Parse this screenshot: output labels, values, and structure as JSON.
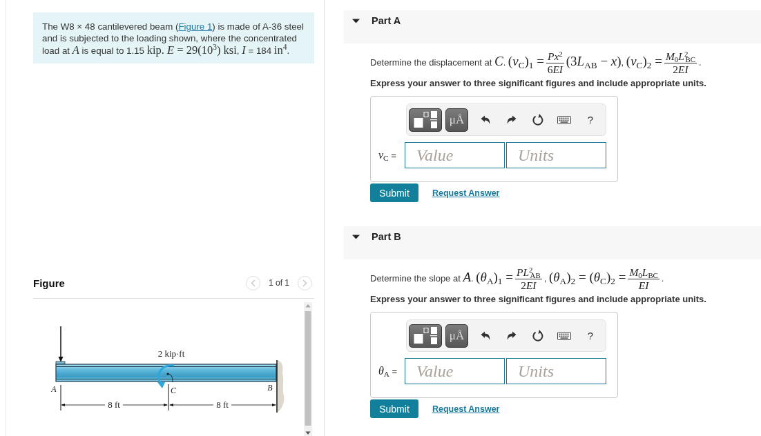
{
  "problem": {
    "text": [
      {
        "kind": "text",
        "text": "The W8 × 48 cantilevered beam ("
      },
      {
        "kind": "link",
        "text": "Figure 1"
      },
      {
        "kind": "text",
        "text": ") is made of A-36 steel and is subjected to the loading shown, where the concentrated load at "
      },
      {
        "kind": "math",
        "text": "*A*"
      },
      {
        "kind": "text",
        "text": " is equal to 1.15 "
      },
      {
        "kind": "math",
        "text": "kip. *E* = 29(10$^{3}$) ksi"
      },
      {
        "kind": "text",
        "text": ", "
      },
      {
        "kind": "math",
        "text": "*I*"
      },
      {
        "kind": "text",
        "text": " = 184 "
      },
      {
        "kind": "math",
        "text": "in$^{4}$"
      },
      {
        "kind": "text",
        "text": "."
      }
    ]
  },
  "figure": {
    "title": "Figure",
    "pager": "1 of 1",
    "previous": {
      "disabled": true
    },
    "next": {
      "disabled": true
    },
    "diagram": {
      "moment": "2 kip·ft",
      "points": [
        "A",
        "C",
        "B"
      ],
      "spans": [
        "8 ft",
        "8 ft"
      ]
    }
  },
  "parts": [
    {
      "title": "Part A",
      "expanded": true,
      "question": [
        {
          "kind": "text",
          "text": "Determine the displacement at "
        },
        {
          "kind": "math",
          "text": "*C*"
        },
        {
          "kind": "text",
          "text": ". "
        },
        {
          "kind": "math",
          "text": "(*v*$_{C}$)$_{1}$ ="
        },
        {
          "kind": "fraction",
          "numerator": [
            "*Px*$^{2}$"
          ],
          "denominator": [
            "6",
            "*EI*"
          ]
        },
        {
          "kind": "math",
          "text": "(3"
        },
        {
          "kind": "math",
          "text": "*L*$_{AB}$ − *x*)"
        },
        {
          "kind": "text",
          "text": ", "
        },
        {
          "kind": "math",
          "text": "(*v*$_{C}$)$_{2}$ ="
        },
        {
          "kind": "fraction",
          "numerator": [
            "*M*$_{0}$*L*$^{2}$$_{BC}$"
          ],
          "denominator": [
            "2",
            "*EI*"
          ]
        },
        {
          "kind": "text",
          "text": "."
        }
      ],
      "instruction": "Express your answer to three significant figures and include appropriate units.",
      "answer": {
        "label": [
          {
            "kind": "math",
            "text": "*v*$_{C}$"
          },
          {
            "kind": "text",
            "text": " ="
          }
        ],
        "toolbar": {
          "symbols": "μÅ",
          "help": "?"
        },
        "value": {
          "placeholder": "Value"
        },
        "units": {
          "placeholder": "Units"
        }
      },
      "submit": "Submit",
      "request_answer": "Request Answer"
    },
    {
      "title": "Part B",
      "expanded": true,
      "question": [
        {
          "kind": "text",
          "text": "Determine the slope at "
        },
        {
          "kind": "math",
          "text": "*A*"
        },
        {
          "kind": "text",
          "text": ". "
        },
        {
          "kind": "math",
          "text": "(*θ*$_{A}$)$_{1}$ ="
        },
        {
          "kind": "fraction",
          "numerator": [
            "*PL*$^{2}$$_{AB}$"
          ],
          "denominator": [
            "2",
            "*EI*"
          ]
        },
        {
          "kind": "text",
          "text": ", "
        },
        {
          "kind": "math",
          "text": "(*θ*$_{A}$)$_{2}$ = (*θ*$_{C}$)$_{2}$ ="
        },
        {
          "kind": "fraction",
          "numerator": [
            "*M*$_{0}$*L*$_{BC}$"
          ],
          "denominator": [
            "*EI*"
          ]
        },
        {
          "kind": "text",
          "text": "."
        }
      ],
      "instruction": "Express your answer to three significant figures and include appropriate units.",
      "answer": {
        "label": [
          {
            "kind": "math",
            "text": "*θ*$_{A}$"
          },
          {
            "kind": "text",
            "text": " ="
          }
        ],
        "toolbar": {
          "symbols": "μÅ",
          "help": "?"
        },
        "value": {
          "placeholder": "Value"
        },
        "units": {
          "placeholder": "Units"
        }
      },
      "submit": "Submit",
      "request_answer": "Request Answer"
    }
  ]
}
